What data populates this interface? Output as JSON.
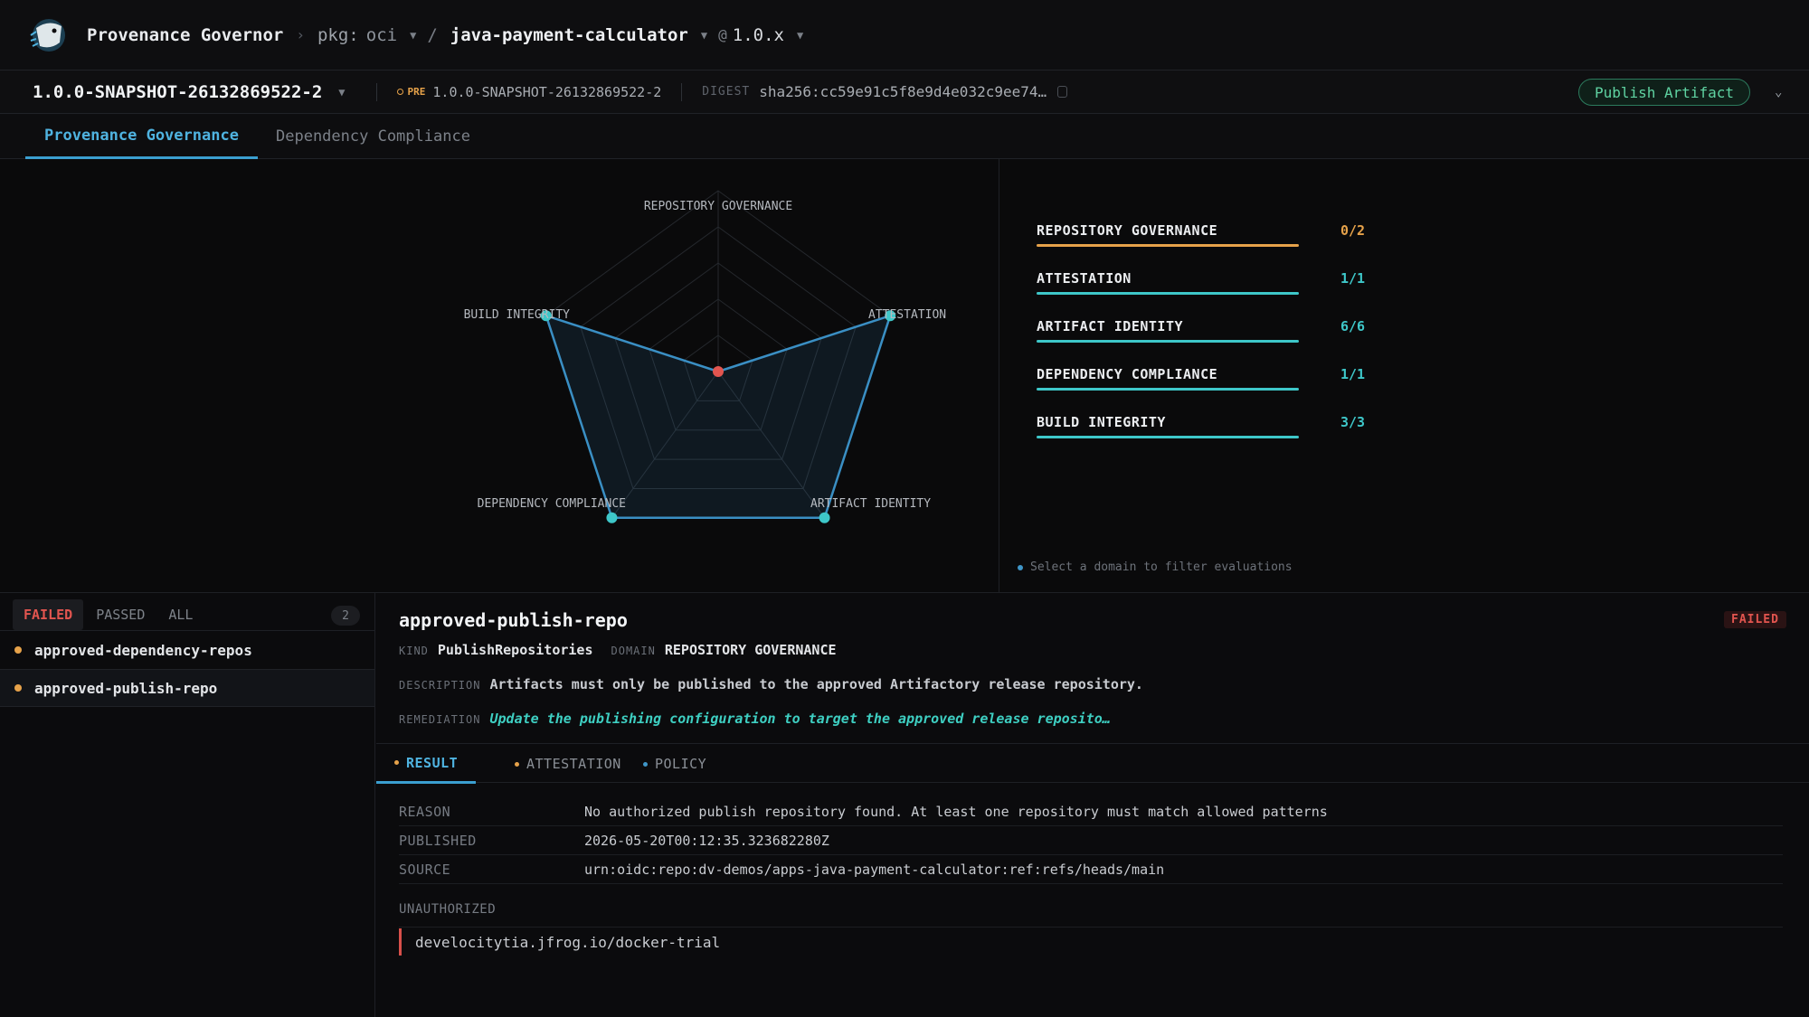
{
  "header": {
    "app_title": "Provenance Governor",
    "pkg_label": "pkg:",
    "pkg_value": "oci",
    "slash": "/",
    "repo": "java-payment-calculator",
    "at": "@",
    "version": "1.0.x"
  },
  "version_bar": {
    "snapshot": "1.0.0-SNAPSHOT-26132869522-2",
    "pre_tag": "PRE",
    "pre_value": "1.0.0-SNAPSHOT-26132869522-2",
    "digest_label": "DIGEST",
    "digest_value": "sha256:cc59e91c5f8e9d4e032c9ee74…",
    "publish_label": "Publish Artifact"
  },
  "tabs": [
    {
      "label": "Provenance Governance",
      "active": true
    },
    {
      "label": "Dependency Compliance",
      "active": false
    }
  ],
  "radar": {
    "axes": [
      "REPOSITORY GOVERNANCE",
      "ATTESTATION",
      "ARTIFACT IDENTITY",
      "DEPENDENCY COMPLIANCE",
      "BUILD INTEGRITY"
    ],
    "values": [
      0.0,
      1.0,
      1.0,
      1.0,
      1.0
    ],
    "rings": 5,
    "fill_color": "#3a8fc4",
    "point_ok_color": "#3ec7c9",
    "point_fail_color": "#e2554f"
  },
  "domains": [
    {
      "name": "REPOSITORY GOVERNANCE",
      "score": "0/2",
      "color": "#e6a24a"
    },
    {
      "name": "ATTESTATION",
      "score": "1/1",
      "color": "#3ec7c9"
    },
    {
      "name": "ARTIFACT IDENTITY",
      "score": "6/6",
      "color": "#3ec7c9"
    },
    {
      "name": "DEPENDENCY COMPLIANCE",
      "score": "1/1",
      "color": "#3ec7c9"
    },
    {
      "name": "BUILD INTEGRITY",
      "score": "3/3",
      "color": "#3ec7c9"
    }
  ],
  "domain_hint": "Select a domain to filter evaluations",
  "filters": [
    {
      "label": "FAILED",
      "active": true
    },
    {
      "label": "PASSED",
      "active": false
    },
    {
      "label": "ALL",
      "active": false
    }
  ],
  "filter_count": "2",
  "rules": [
    {
      "name": "approved-dependency-repos",
      "selected": false
    },
    {
      "name": "approved-publish-repo",
      "selected": true
    }
  ],
  "detail": {
    "title": "approved-publish-repo",
    "status": "FAILED",
    "kind_label": "KIND",
    "kind": "PublishRepositories",
    "domain_label": "DOMAIN",
    "domain": "REPOSITORY GOVERNANCE",
    "description_label": "DESCRIPTION",
    "description": "Artifacts must only be published to the approved Artifactory release repository.",
    "remediation_label": "REMEDIATION",
    "remediation": "Update the publishing configuration to target the approved release reposito…",
    "result_tabs": [
      {
        "label": "RESULT",
        "active": true,
        "dot": "#e6a24a"
      },
      {
        "label": "ATTESTATION",
        "active": false,
        "dot": "#e6a24a"
      },
      {
        "label": "POLICY",
        "active": false,
        "dot": "#3f96c8"
      }
    ],
    "fields": [
      {
        "key": "REASON",
        "value": "No authorized publish repository found. At least one repository must match allowed patterns"
      },
      {
        "key": "PUBLISHED",
        "value": "2026-05-20T00:12:35.323682280Z"
      },
      {
        "key": "SOURCE",
        "value": "urn:oidc:repo:dv-demos/apps-java-payment-calculator:ref:refs/heads/main"
      }
    ],
    "unauthorized_label": "UNAUTHORIZED",
    "unauthorized": [
      "develocitytia.jfrog.io/docker-trial"
    ]
  }
}
